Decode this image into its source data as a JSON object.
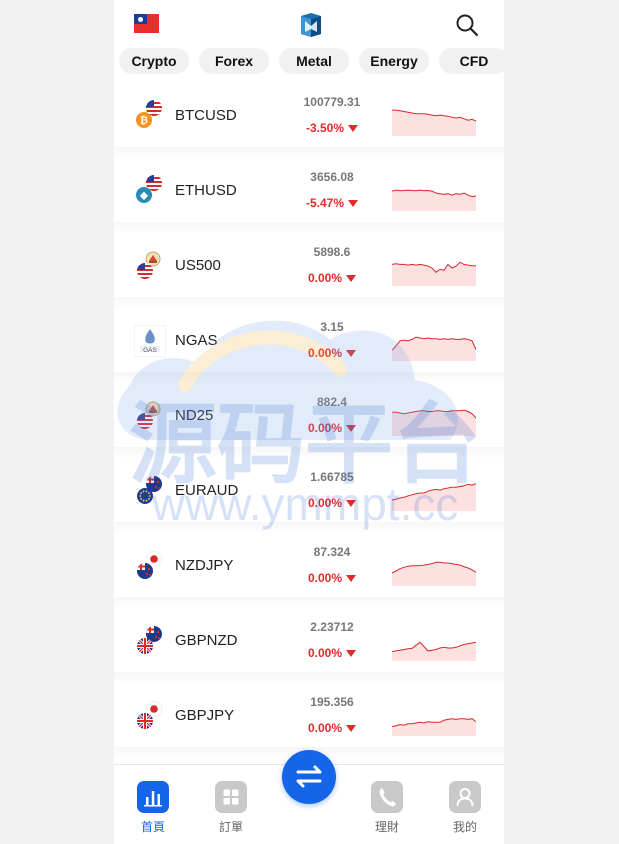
{
  "header": {
    "region_flag_icon": "taiwan-flag-icon",
    "logo_icon": "app-logo-icon",
    "search_icon": "search-icon"
  },
  "categories": [
    {
      "label": "Crypto"
    },
    {
      "label": "Forex"
    },
    {
      "label": "Metal"
    },
    {
      "label": "Energy"
    },
    {
      "label": "CFD"
    }
  ],
  "markets": [
    {
      "symbol": "BTCUSD",
      "price": "100779.31",
      "change": "-3.50%",
      "icon": "usd-btc-pair-icon",
      "trend": [
        0.72,
        0.72,
        0.7,
        0.68,
        0.66,
        0.64,
        0.62,
        0.62,
        0.62,
        0.6,
        0.58,
        0.56,
        0.58,
        0.56,
        0.55,
        0.52,
        0.5,
        0.52,
        0.48,
        0.44,
        0.46,
        0.42
      ]
    },
    {
      "symbol": "ETHUSD",
      "price": "3656.08",
      "change": "-5.47%",
      "icon": "usd-eth-pair-icon",
      "trend": [
        0.55,
        0.58,
        0.56,
        0.57,
        0.58,
        0.57,
        0.56,
        0.58,
        0.56,
        0.57,
        0.55,
        0.5,
        0.48,
        0.46,
        0.48,
        0.44,
        0.48,
        0.46,
        0.5,
        0.44,
        0.4,
        0.42
      ]
    },
    {
      "symbol": "US500",
      "price": "5898.6",
      "change": "0.00%",
      "icon": "us500-index-icon",
      "trend": [
        0.6,
        0.62,
        0.6,
        0.6,
        0.58,
        0.6,
        0.58,
        0.6,
        0.58,
        0.55,
        0.5,
        0.38,
        0.46,
        0.44,
        0.6,
        0.5,
        0.55,
        0.66,
        0.6,
        0.58,
        0.56,
        0.56
      ]
    },
    {
      "symbol": "NGAS",
      "price": "3.15",
      "change": "0.00%",
      "icon": "natural-gas-icon",
      "trend": [
        0.3,
        0.42,
        0.56,
        0.58,
        0.56,
        0.6,
        0.66,
        0.64,
        0.62,
        0.64,
        0.62,
        0.62,
        0.6,
        0.62,
        0.6,
        0.62,
        0.6,
        0.6,
        0.62,
        0.6,
        0.56,
        0.32
      ]
    },
    {
      "symbol": "ND25",
      "price": "882.4",
      "change": "0.00%",
      "icon": "nd25-index-icon",
      "trend": [
        0.66,
        0.66,
        0.64,
        0.62,
        0.64,
        0.66,
        0.68,
        0.7,
        0.7,
        0.68,
        0.68,
        0.7,
        0.7,
        0.68,
        0.68,
        0.7,
        0.7,
        0.7,
        0.72,
        0.68,
        0.62,
        0.5
      ]
    },
    {
      "symbol": "EURAUD",
      "price": "1.66785",
      "change": "0.00%",
      "icon": "eur-aud-pair-icon",
      "trend": [
        0.3,
        0.33,
        0.36,
        0.38,
        0.42,
        0.45,
        0.48,
        0.5,
        0.5,
        0.55,
        0.58,
        0.6,
        0.58,
        0.62,
        0.64,
        0.66,
        0.66,
        0.68,
        0.7,
        0.74,
        0.72,
        0.76
      ]
    },
    {
      "symbol": "NZDJPY",
      "price": "87.324",
      "change": "0.00%",
      "icon": "nzd-jpy-pair-icon",
      "trend": [
        0.36,
        0.42,
        0.48,
        0.52,
        0.55,
        0.56,
        0.56,
        0.57,
        0.58,
        0.6,
        0.62,
        0.66,
        0.66,
        0.64,
        0.64,
        0.62,
        0.6,
        0.58,
        0.54,
        0.5,
        0.45,
        0.38
      ]
    },
    {
      "symbol": "GBPNZD",
      "price": "2.23712",
      "change": "0.00%",
      "icon": "gbp-nzd-pair-icon",
      "trend": [
        0.26,
        0.28,
        0.3,
        0.32,
        0.34,
        0.35,
        0.44,
        0.52,
        0.4,
        0.28,
        0.3,
        0.32,
        0.36,
        0.38,
        0.36,
        0.36,
        0.38,
        0.42,
        0.46,
        0.48,
        0.5,
        0.52
      ]
    },
    {
      "symbol": "GBPJPY",
      "price": "195.356",
      "change": "0.00%",
      "icon": "gbp-jpy-pair-icon",
      "trend": [
        0.26,
        0.28,
        0.32,
        0.3,
        0.34,
        0.34,
        0.36,
        0.38,
        0.36,
        0.4,
        0.38,
        0.38,
        0.38,
        0.44,
        0.46,
        0.48,
        0.46,
        0.48,
        0.48,
        0.46,
        0.48,
        0.4
      ]
    }
  ],
  "tabbar": {
    "home": "首頁",
    "orders": "訂單",
    "wealth": "理財",
    "mine": "我的",
    "trade_icon": "swap-arrows-icon"
  },
  "watermark": {
    "title": "源码平台",
    "url": "www.ymmpt.cc"
  },
  "colors": {
    "accent": "#1565e8",
    "down": "#e02b2b",
    "spark_line": "#d9272c",
    "spark_fill": "#fde1e1"
  }
}
